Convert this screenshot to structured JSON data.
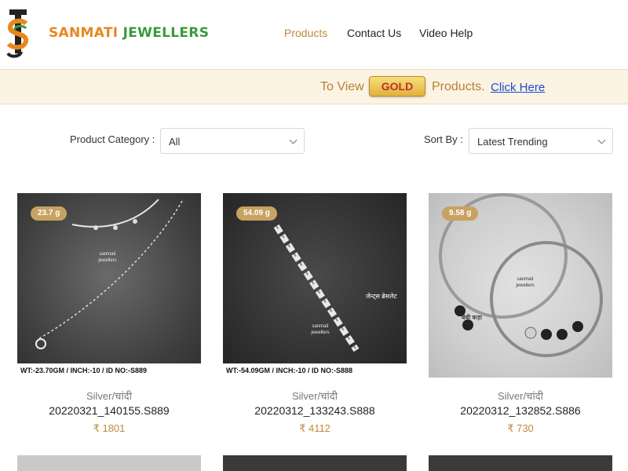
{
  "header": {
    "brand_part1": "SANMATI ",
    "brand_part2": "JEWELLERS",
    "nav": [
      {
        "label": "Products",
        "active": true
      },
      {
        "label": "Contact Us",
        "active": false
      },
      {
        "label": "Video Help",
        "active": false
      }
    ]
  },
  "banner": {
    "text_before": "To View",
    "gold_label": "GOLD",
    "text_after": "Products.",
    "link_label": "Click Here"
  },
  "filters": {
    "category_label": "Product Category :",
    "category_value": "All",
    "sort_label": "Sort By :",
    "sort_value": "Latest Trending"
  },
  "products": [
    {
      "weight": "23.7 g",
      "category": "Silver/चांदी",
      "name": "20220321_140155.S889",
      "price": "₹ 1801",
      "caption": "WT:-23.70GM / INCH:-10 / ID NO:-S889",
      "watermark": "sanmati jewellers"
    },
    {
      "weight": "54.09 g",
      "category": "Silver/चांदी",
      "name": "20220312_133243.S888",
      "price": "₹ 4112",
      "caption": "WT:-54.09GM / INCH:-10 / ID NO:-S888",
      "watermark": "sanmati jewellers",
      "image_label": "जेन्ट्स ब्रेसलेट"
    },
    {
      "weight": "9.58 g",
      "category": "Silver/चांदी",
      "name": "20220312_132852.S886",
      "price": "₹ 730",
      "watermark": "sanmati jewellers",
      "image_label": "बेबी कड़ा"
    }
  ],
  "colors": {
    "accent": "#c0883a",
    "brand_orange": "#e8871e",
    "brand_green": "#3a9a3a",
    "banner_bg": "#fdf3e2",
    "link": "#1a4bd4",
    "badge": "#c8a262"
  },
  "icons": [
    "logo-mark-icon",
    "chevron-down-icon"
  ]
}
